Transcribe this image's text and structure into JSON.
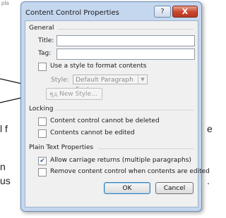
{
  "background": {
    "corner_text": "pla",
    "letters": [
      "l f",
      "e",
      "n",
      "us",
      "."
    ]
  },
  "dialog": {
    "title": "Content Control Properties",
    "help_label": "?",
    "close_label": "X",
    "general": {
      "section_label": "General",
      "title_label": "Title:",
      "title_value": "",
      "tag_label": "Tag:",
      "tag_value": "",
      "use_style_label": "Use a style to format contents",
      "use_style_checked": false,
      "style_label": "Style:",
      "style_value": "Default Paragraph Font",
      "new_style_label": "New Style..."
    },
    "locking": {
      "section_label": "Locking",
      "cannot_delete_label": "Content control cannot be deleted",
      "cannot_delete_checked": false,
      "cannot_edit_label": "Contents cannot be edited",
      "cannot_edit_checked": false
    },
    "plain_text": {
      "section_label": "Plain Text Properties",
      "allow_returns_label": "Allow carriage returns (multiple paragraphs)",
      "allow_returns_checked": true,
      "remove_label": "Remove content control when contents are edited",
      "remove_checked": false
    },
    "ok_label": "OK",
    "cancel_label": "Cancel"
  },
  "colors": {
    "dialog_frame": "#c4d7ee",
    "close_button": "#c8452b",
    "check_mark": "#2a5aa8"
  }
}
